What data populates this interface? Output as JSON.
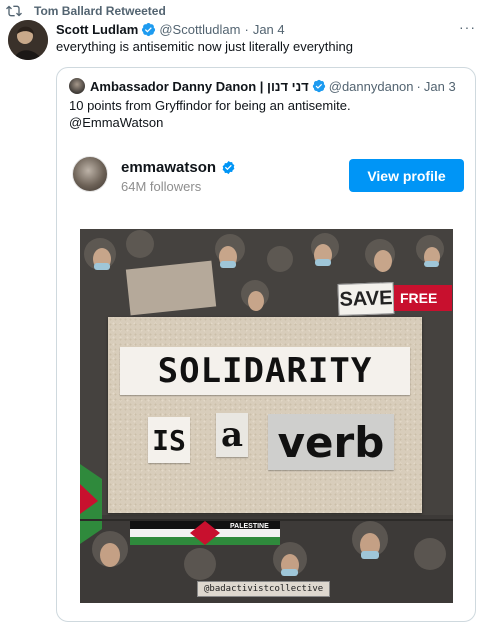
{
  "retweet": {
    "label": "Tom Ballard Retweeted"
  },
  "tweet": {
    "display_name": "Scott Ludlam",
    "handle": "@Scottludlam",
    "separator": "·",
    "date": "Jan 4",
    "text": "everything is antisemitic now just literally everything",
    "more": "···"
  },
  "quote": {
    "display_name": "Ambassador Danny Danon | דני דנון",
    "handle": "@dannydanon",
    "separator": "·",
    "date": "Jan 3",
    "text_line1": "10 points from Gryffindor for being an antisemite.",
    "text_line2": "@EmmaWatson"
  },
  "instagram": {
    "username": "emmawatson",
    "followers": "64M followers",
    "view_profile_label": "View profile"
  },
  "post_image": {
    "headline_word1": "SOLIDARITY",
    "word_is": "IS",
    "word_a": "a",
    "word_verb": "verb",
    "sign_save": "SAVE",
    "sign_free": "FREE",
    "banner_text": "PALESTINE",
    "watermark": "@badactivistcollective"
  },
  "colors": {
    "verified_blue": "#1d9bf0",
    "instagram_button": "#0095f6",
    "secondary_text": "#536471"
  }
}
